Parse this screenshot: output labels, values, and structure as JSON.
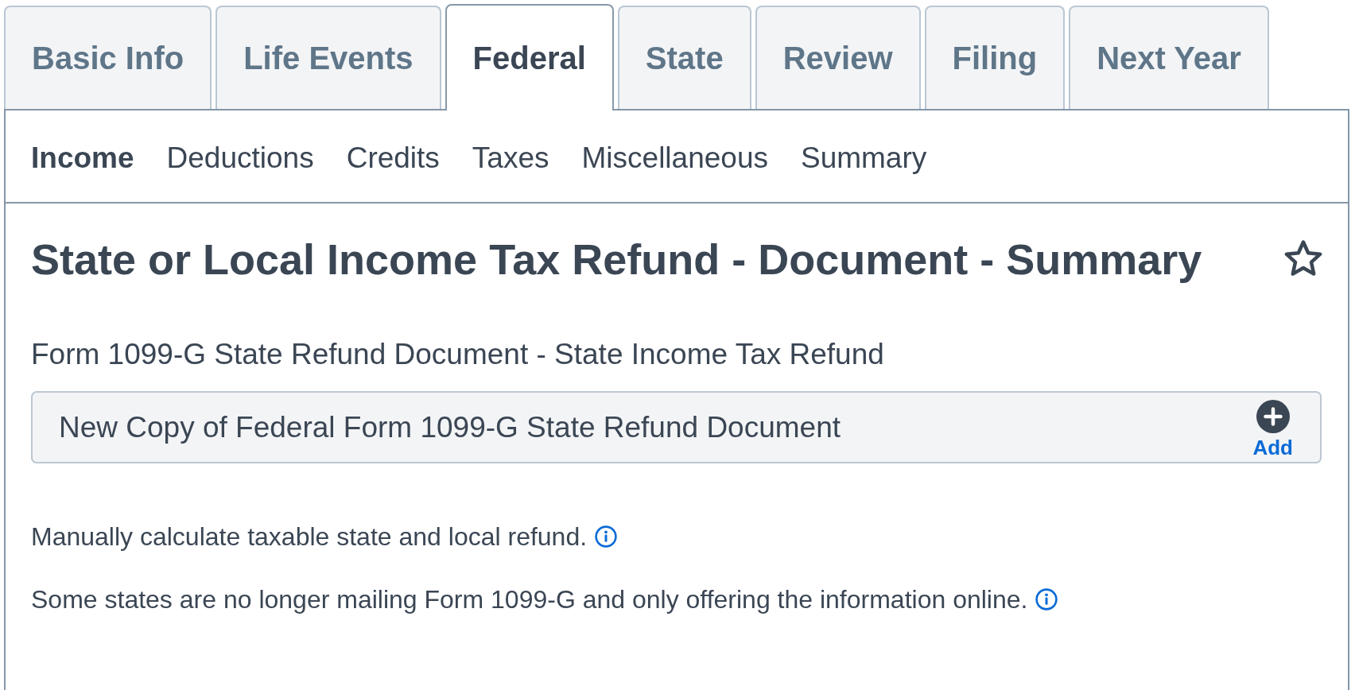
{
  "tabs": [
    {
      "label": "Basic Info",
      "selected": false
    },
    {
      "label": "Life Events",
      "selected": false
    },
    {
      "label": "Federal",
      "selected": true
    },
    {
      "label": "State",
      "selected": false
    },
    {
      "label": "Review",
      "selected": false
    },
    {
      "label": "Filing",
      "selected": false
    },
    {
      "label": "Next Year",
      "selected": false
    }
  ],
  "subnav": [
    {
      "label": "Income",
      "selected": true
    },
    {
      "label": "Deductions",
      "selected": false
    },
    {
      "label": "Credits",
      "selected": false
    },
    {
      "label": "Taxes",
      "selected": false
    },
    {
      "label": "Miscellaneous",
      "selected": false
    },
    {
      "label": "Summary",
      "selected": false
    }
  ],
  "page": {
    "title": "State or Local Income Tax Refund - Document - Summary",
    "favorite": false
  },
  "document_section": {
    "label": "Form 1099-G State Refund Document - State Income Tax Refund",
    "items": [
      {
        "name": "New Copy of Federal Form 1099-G State Refund Document",
        "action": "Add"
      }
    ]
  },
  "notes": [
    "Manually calculate taxable state and local refund.",
    "Some states are no longer mailing Form 1099-G and only offering the information online."
  ]
}
